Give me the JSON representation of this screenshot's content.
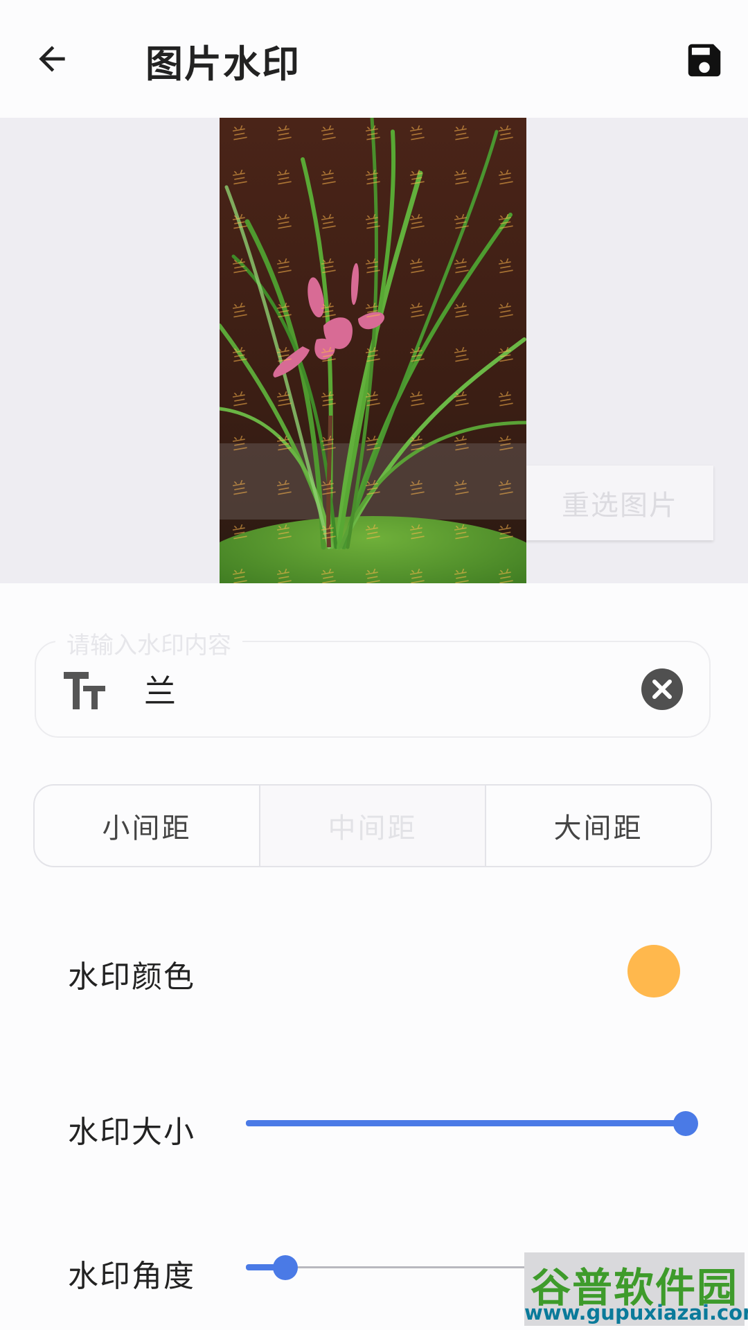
{
  "appbar": {
    "title": "图片水印"
  },
  "preview": {
    "reselect_label": "重选图片",
    "watermark_tile_text": "兰"
  },
  "watermark_input": {
    "legend": "请输入水印内容",
    "value": "兰"
  },
  "spacing": {
    "options": [
      "小间距",
      "中间距",
      "大间距"
    ],
    "selected": "中间距"
  },
  "color_row": {
    "label": "水印颜色",
    "color": "#ffb84d"
  },
  "size_row": {
    "label": "水印大小",
    "value_fraction": 1.0
  },
  "angle_row": {
    "label": "水印角度",
    "value_fraction": 0.09
  },
  "accent_color": "#4a7ae6",
  "site_badge": {
    "line1": "谷普软件园",
    "line2": "www.gupuxiazai.com"
  }
}
